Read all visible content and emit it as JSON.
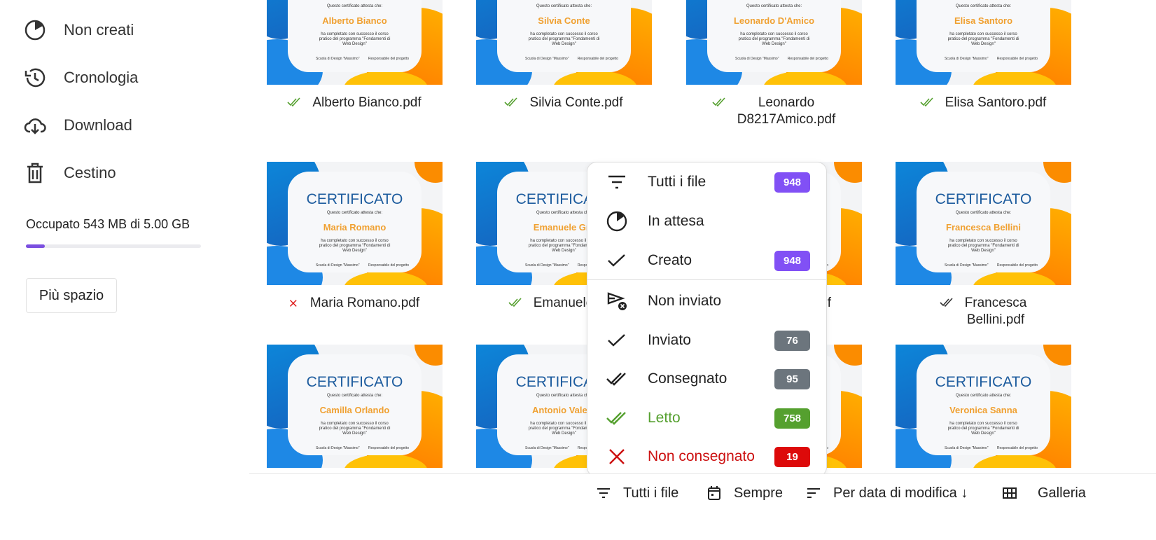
{
  "sidebar": {
    "items": [
      {
        "label": "Non creati",
        "icon": "pie-clock-icon"
      },
      {
        "label": "Cronologia",
        "icon": "history-icon"
      },
      {
        "label": "Download",
        "icon": "cloud-download-icon"
      },
      {
        "label": "Cestino",
        "icon": "trash-icon"
      }
    ],
    "storage_text": "Occupato 543 MB di 5.00 GB",
    "storage_fraction": 0.109,
    "more_space_label": "Più spazio"
  },
  "certificate": {
    "title": "CERTIFICATO",
    "subtitle": "Questo certificato attesta che:",
    "body": "ha completato con successo il corso pratico del programma \"Fondamenti di Web Design\"",
    "sig_left": "Scuola di Design \"Massimo\"",
    "sig_right": "Responsabile del progetto"
  },
  "files": [
    {
      "name": "Alberto Bianco",
      "filename": "Alberto Bianco.pdf",
      "status": "letto"
    },
    {
      "name": "Silvia Conte",
      "filename": "Silvia Conte.pdf",
      "status": "letto"
    },
    {
      "name": "Leonardo D'Amico",
      "filename": "Leonardo D8217Amico.pdf",
      "status": "letto"
    },
    {
      "name": "Elisa Santoro",
      "filename": "Elisa Santoro.pdf",
      "status": "letto"
    },
    {
      "name": "Maria Romano",
      "filename": "Maria Romano.pdf",
      "status": "non-consegnato"
    },
    {
      "name": "Emanuele Gra",
      "filename": "Emanuele Gra",
      "status": "letto"
    },
    {
      "name": "",
      "filename": "f",
      "status": ""
    },
    {
      "name": "Francesca Bellini",
      "filename": "Francesca Bellini.pdf",
      "status": "consegnato"
    },
    {
      "name": "Camilla Orlando",
      "filename": "",
      "status": ""
    },
    {
      "name": "Antonio Valent",
      "filename": "",
      "status": ""
    },
    {
      "name": "",
      "filename": "",
      "status": ""
    },
    {
      "name": "Veronica Sanna",
      "filename": "",
      "status": ""
    }
  ],
  "filter_menu": {
    "items": [
      {
        "label": "Tutti i file",
        "icon": "filter-icon",
        "count": "948",
        "badge_color": "#8150f5"
      },
      {
        "label": "In attesa",
        "icon": "pie-clock-icon",
        "count": null
      },
      {
        "label": "Creato",
        "icon": "check-icon",
        "count": "948",
        "badge_color": "#8150f5"
      },
      {
        "label": "Non inviato",
        "icon": "send-x-icon",
        "count": null
      },
      {
        "label": "Inviato",
        "icon": "check-icon",
        "count": "76",
        "badge_color": "#6c757d"
      },
      {
        "label": "Consegnato",
        "icon": "double-check-icon",
        "count": "95",
        "badge_color": "#6c757d"
      },
      {
        "label": "Letto",
        "icon": "double-check-icon",
        "count": "758",
        "badge_color": "#55a02f",
        "color": "#55a02f"
      },
      {
        "label": "Non consegnato",
        "icon": "x-icon",
        "count": "19",
        "badge_color": "#dd0a0a",
        "color": "#cc1111"
      }
    ]
  },
  "toolbar": {
    "filter_label": "Tutti i file",
    "date_label": "Sempre",
    "sort_label": "Per data di modifica ↓",
    "view_label": "Galleria"
  }
}
